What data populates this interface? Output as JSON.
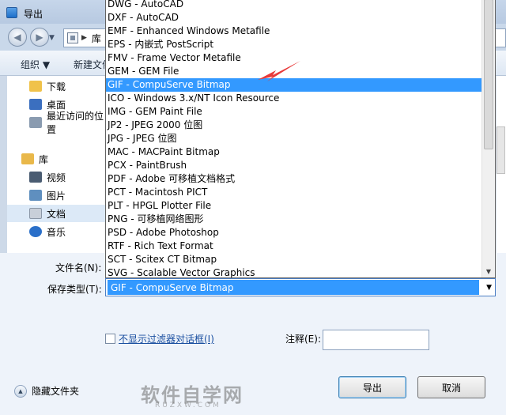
{
  "window": {
    "title": "导出"
  },
  "address": {
    "path": "库"
  },
  "toolbar": {
    "organize": "组织 ▼",
    "new_folder": "新建文件"
  },
  "nav": {
    "items": [
      {
        "label": "下载",
        "icon": "download-folder-icon",
        "color": "#f0c24a"
      },
      {
        "label": "桌面",
        "icon": "desktop-icon",
        "color": "#3b6fbf"
      },
      {
        "label": "最近访问的位置",
        "icon": "recent-places-icon",
        "color": "#8a9bb0"
      },
      {
        "label": "库",
        "icon": "libraries-icon",
        "color": "#e9b84a"
      },
      {
        "label": "视频",
        "icon": "videos-icon",
        "color": "#4a5c72"
      },
      {
        "label": "图片",
        "icon": "pictures-icon",
        "color": "#5f8fbf"
      },
      {
        "label": "文档",
        "icon": "documents-icon",
        "color": "#c8cfd9"
      },
      {
        "label": "音乐",
        "icon": "music-icon",
        "color": "#2a6fc9"
      }
    ]
  },
  "form": {
    "filename_label": "文件名(N):",
    "savetype_label": "保存类型(T):",
    "savetype_value": "GIF - CompuServe Bitmap",
    "hide_filter_label": "不显示过滤器对话框(I)",
    "comment_label": "注释(E):"
  },
  "buttons": {
    "export": "导出",
    "cancel": "取消",
    "hide_folders": "隐藏文件夹"
  },
  "watermark": {
    "text": "软件自学网",
    "sub": "RUZXW.COM"
  },
  "dropdown": {
    "selected_index": 6,
    "options": [
      "DWG - AutoCAD",
      "DXF - AutoCAD",
      "EMF - Enhanced Windows Metafile",
      "EPS - 内嵌式 PostScript",
      "FMV - Frame Vector Metafile",
      "GEM - GEM File",
      "GIF - CompuServe Bitmap",
      "ICO - Windows 3.x/NT Icon Resource",
      "IMG - GEM Paint File",
      "JP2 - JPEG 2000 位图",
      "JPG - JPEG 位图",
      "MAC - MACPaint Bitmap",
      "PCX - PaintBrush",
      "PDF - Adobe 可移植文档格式",
      "PCT - Macintosh PICT",
      "PLT - HPGL Plotter File",
      "PNG - 可移植网络图形",
      "PSD - Adobe Photoshop",
      "RTF - Rich Text Format",
      "SCT - Scitex CT Bitmap",
      "SVG - Scalable Vector Graphics"
    ]
  },
  "colors": {
    "highlight": "#3399ff",
    "annotation_arrow": "#e83a3a"
  }
}
